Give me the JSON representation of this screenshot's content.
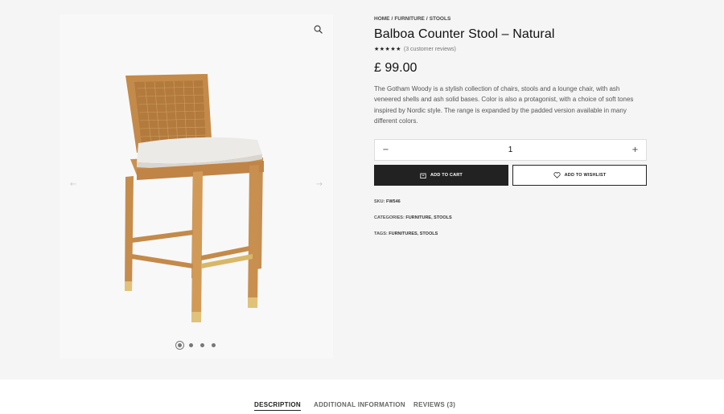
{
  "gallery": {
    "zoom_icon": "search-icon",
    "prev_icon": "arrow-left-icon",
    "next_icon": "arrow-right-icon",
    "prev_glyph": "←",
    "next_glyph": "→",
    "dot_count": 4,
    "active_dot": 0
  },
  "breadcrumb": {
    "items": [
      "HOME",
      "FURNITURE",
      "STOOLS"
    ],
    "separator": "/"
  },
  "product": {
    "title": "Balboa Counter Stool – Natural",
    "stars": "★★★★★",
    "rating": 5,
    "reviews_link": "(3 customer reviews)",
    "price": "£ 99.00",
    "description": "The Gotham Woody is a stylish collection of chairs, stools and a lounge chair, with ash veneered shells and ash solid bases. Color is also a protagonist, with a choice of soft tones inspired by Nordic style. The range is expanded by the padded version available in many different colors."
  },
  "quantity": {
    "minus": "−",
    "plus": "+",
    "value": "1"
  },
  "actions": {
    "add_to_cart": "ADD TO CART",
    "add_to_wishlist": "ADD TO WISHLIST",
    "cart_icon": "bag-icon",
    "wishlist_icon": "heart-icon"
  },
  "meta": {
    "sku_label": "SKU:",
    "sku_value": "FW546",
    "categories_label": "CATEGORIES:",
    "categories": [
      "FURNITURE",
      "STOOLS"
    ],
    "tags_label": "TAGS:",
    "tags": [
      "FURNITURES",
      "STOOLS"
    ]
  },
  "tabs": [
    {
      "label": "DESCRIPTION",
      "active": true
    },
    {
      "label": "ADDITIONAL INFORMATION",
      "active": false
    },
    {
      "label": "REVIEWS (3)",
      "active": false
    }
  ],
  "colors": {
    "background": "#f5f5f5",
    "dark": "#222222",
    "wood": "#c99a5b",
    "cushion": "#ecebe8",
    "brass": "#d4b060"
  }
}
